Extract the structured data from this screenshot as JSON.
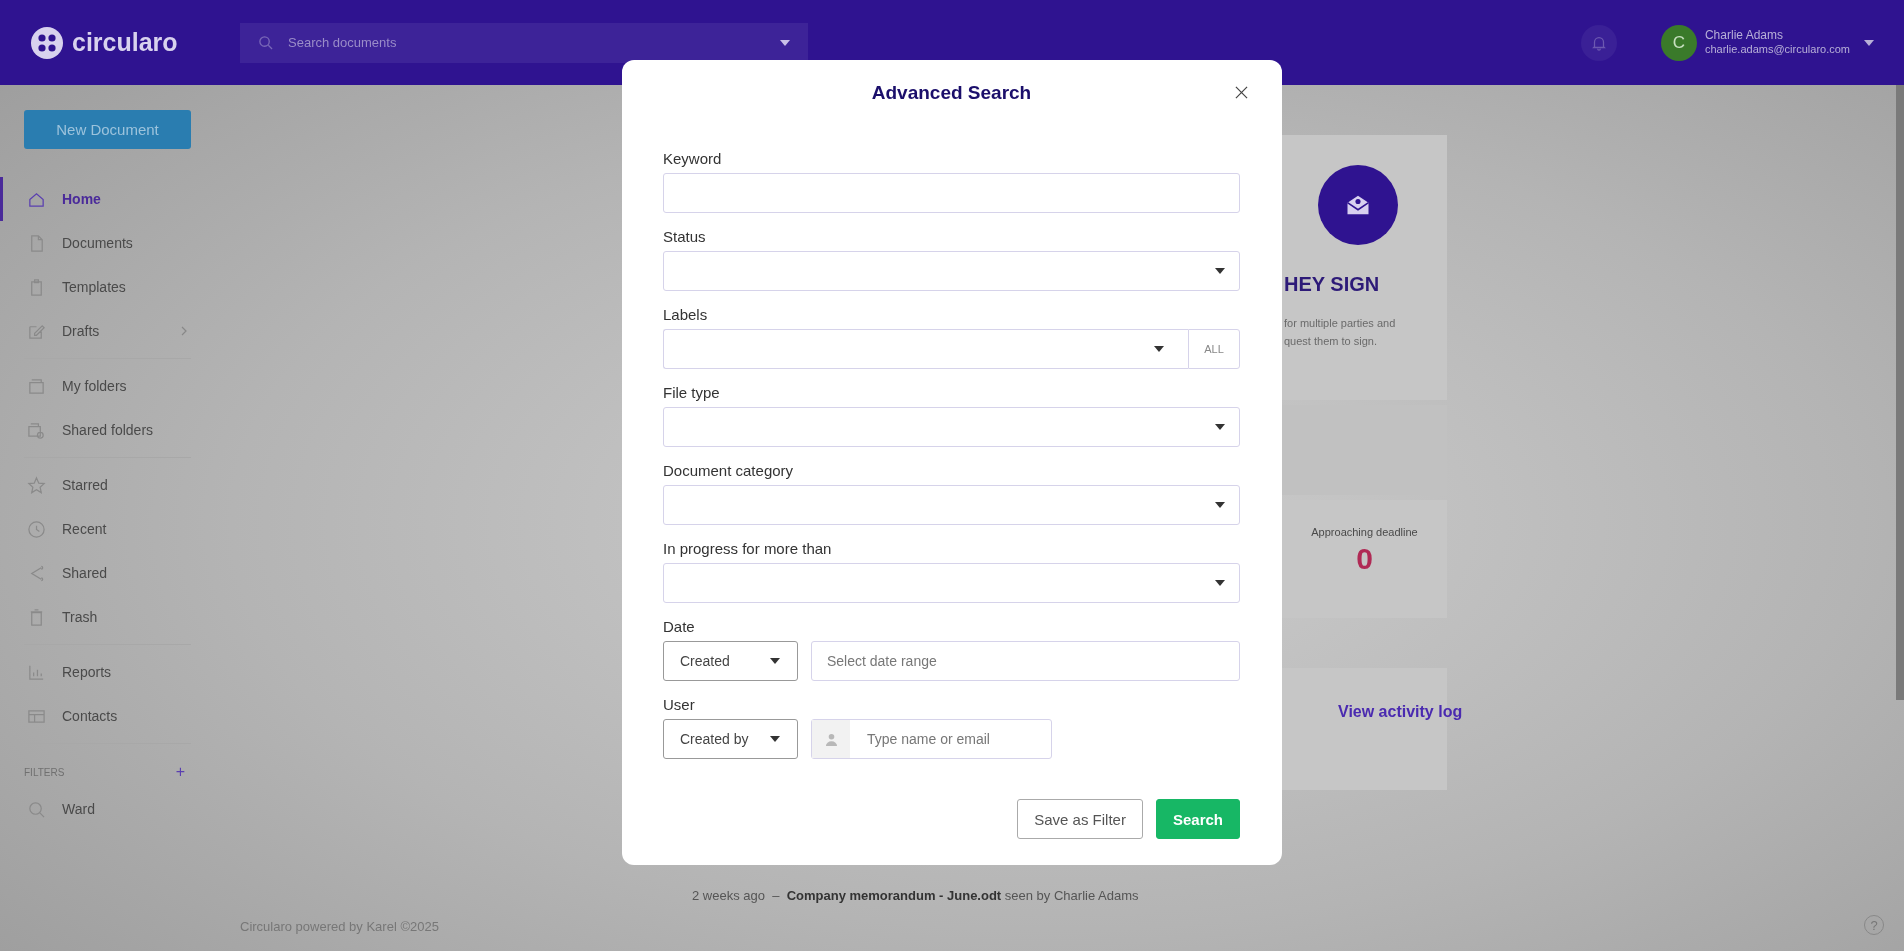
{
  "top_bar": {
    "logo": "circularo",
    "search": {
      "placeholder": "Search documents"
    },
    "user": {
      "initial": "C",
      "name": "Charlie Adams",
      "email": "charlie.adams@circularo.com"
    }
  },
  "sidebar": {
    "new_button": "New Document",
    "groups": [
      [
        {
          "label": "Home",
          "selected": true,
          "submenu": false
        },
        {
          "label": "Documents",
          "selected": false,
          "submenu": false
        },
        {
          "label": "Templates",
          "selected": false,
          "submenu": false
        },
        {
          "label": "Drafts",
          "selected": false,
          "submenu": true
        }
      ],
      [
        {
          "label": "My folders",
          "selected": false,
          "submenu": false
        },
        {
          "label": "Shared folders",
          "selected": false,
          "submenu": false
        }
      ],
      [
        {
          "label": "Starred",
          "selected": false,
          "submenu": false
        },
        {
          "label": "Recent",
          "selected": false,
          "submenu": false
        },
        {
          "label": "Shared",
          "selected": false,
          "submenu": false
        },
        {
          "label": "Trash",
          "selected": false,
          "submenu": false
        }
      ],
      [
        {
          "label": "Reports",
          "selected": false,
          "submenu": false
        },
        {
          "label": "Contacts",
          "selected": false,
          "submenu": false
        }
      ]
    ],
    "filters": {
      "title": "FILTERS",
      "add": "+",
      "items": [
        {
          "label": "Ward",
          "selected": false
        }
      ]
    }
  },
  "dashboard": {
    "sign_card": {
      "title": "HEY SIGN",
      "lines": [
        "for multiple parties and",
        "quest them to sign."
      ]
    },
    "stat": {
      "label": "Approaching deadline",
      "value": "0"
    },
    "activity_link": "View activity log",
    "activity": [
      {
        "time": "2 weeks ago",
        "separator": "–",
        "document": "Company memorandum - June.odt",
        "action": "seen by Charlie Adams"
      }
    ]
  },
  "footer": "Circularo powered by Karel ©2025",
  "help": "?",
  "dialog": {
    "title": "Advanced Search",
    "fields": [
      {
        "label": "Keyword",
        "kind": "text"
      },
      {
        "label": "Status",
        "kind": "select"
      },
      {
        "label": "Labels",
        "kind": "select_addon",
        "addon": "ALL"
      },
      {
        "label": "File type",
        "kind": "select"
      },
      {
        "label": "Document category",
        "kind": "select"
      },
      {
        "label": "In progress for more than",
        "kind": "select"
      },
      {
        "label": "Date",
        "kind": "date",
        "mode": "Created",
        "placeholder": "Select date range"
      },
      {
        "label": "User",
        "kind": "user",
        "mode": "Created by",
        "placeholder": "Type name or email"
      }
    ],
    "buttons": [
      {
        "label": "Save as Filter",
        "kind": "secondary"
      },
      {
        "label": "Search",
        "kind": "primary"
      }
    ]
  }
}
